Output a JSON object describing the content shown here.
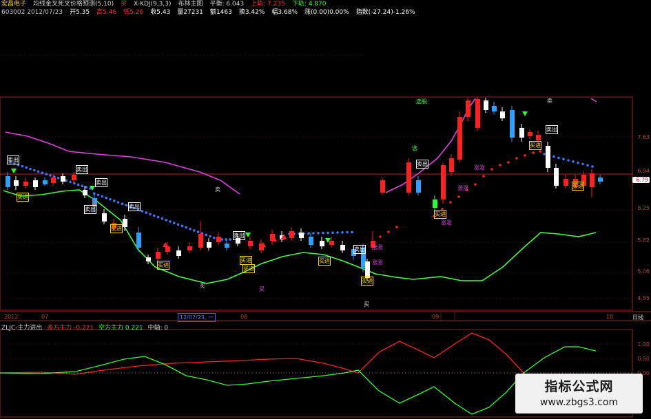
{
  "header": {
    "line1": [
      {
        "text": "宏昌电子",
        "color": "#ffd700"
      },
      {
        "text": "均线金叉死叉价格预测(5,10)",
        "color": "#d0d0d0"
      },
      {
        "text": "买",
        "color": "#ff3030"
      },
      {
        "text": "X-KDJ(9,3,3)",
        "color": "#d0d0d0"
      },
      {
        "text": "布林主图",
        "color": "#d0d0d0"
      },
      {
        "text": "平衡: 6.043",
        "color": "#d0d0d0"
      },
      {
        "text": "上轨: 7.235",
        "color": "#ff3030"
      },
      {
        "text": "下轨: 4.870",
        "color": "#30ff30"
      }
    ],
    "line2": [
      {
        "text": "603002 2012/07/23",
        "color": "#c8c8c8"
      },
      {
        "text": "开5.35",
        "color": "#ffffff"
      },
      {
        "text": "高5.46",
        "color": "#ff3030"
      },
      {
        "text": "低5.26",
        "color": "#ff3030"
      },
      {
        "text": "收5.43",
        "color": "#ffffff"
      },
      {
        "text": "量27231",
        "color": "#ffffff"
      },
      {
        "text": "额1463",
        "color": "#ffffff"
      },
      {
        "text": "换3.42%",
        "color": "#ffffff"
      },
      {
        "text": "幅3.68%",
        "color": "#ffffff"
      },
      {
        "text": "涨(0.00)0.00%",
        "color": "#ffffff"
      },
      {
        "text": "指数(-27.24)-1.26%",
        "color": "#ffffff"
      }
    ]
  },
  "price_axis": {
    "labels": [
      "7.63",
      "6.94",
      "6.79",
      "6.25",
      "5.62",
      "5.06",
      "4.55"
    ],
    "current_price": "6.79",
    "current_price_color": "#ff3030"
  },
  "time_axis": {
    "labels": [
      "2012",
      "07",
      "12/07/23, 一",
      "08",
      "09",
      "10"
    ],
    "period": "日线"
  },
  "indicator": {
    "name": "ZLJC-主力进出",
    "items": [
      {
        "text": "多方主力 -0.221",
        "color": "#ff3030"
      },
      {
        "text": "空方主力 0.221",
        "color": "#30ff30"
      },
      {
        "text": "中轴: 0",
        "color": "#d0d0d0"
      }
    ],
    "y_labels": [
      "1.00",
      "0.50",
      "0.00"
    ]
  },
  "signals": [
    "卖出",
    "买进",
    "卖出",
    "卖出",
    "买进",
    "卖出",
    "买进",
    "卖出",
    "买进",
    "买进",
    "卖出",
    "买进",
    "卖出",
    "买进",
    "买进",
    "卖出",
    "买进",
    "卖出",
    "买进",
    "卖",
    "买",
    "买",
    "买",
    "卖",
    "涨涨",
    "涨涨",
    "涨涨",
    "涨涨",
    "涨涨",
    "选",
    "选股",
    "1"
  ],
  "watermark": {
    "title": "指标公式网",
    "url": "www.zbgs3.com"
  },
  "chart_data": {
    "type": "candlestick",
    "price_axis_ticks": [
      7.63,
      6.94,
      6.25,
      5.62,
      5.06,
      4.55
    ],
    "indicator_series": [
      {
        "name": "多方主力",
        "color": "#ff3030"
      },
      {
        "name": "空方主力",
        "color": "#30ff30"
      }
    ]
  }
}
